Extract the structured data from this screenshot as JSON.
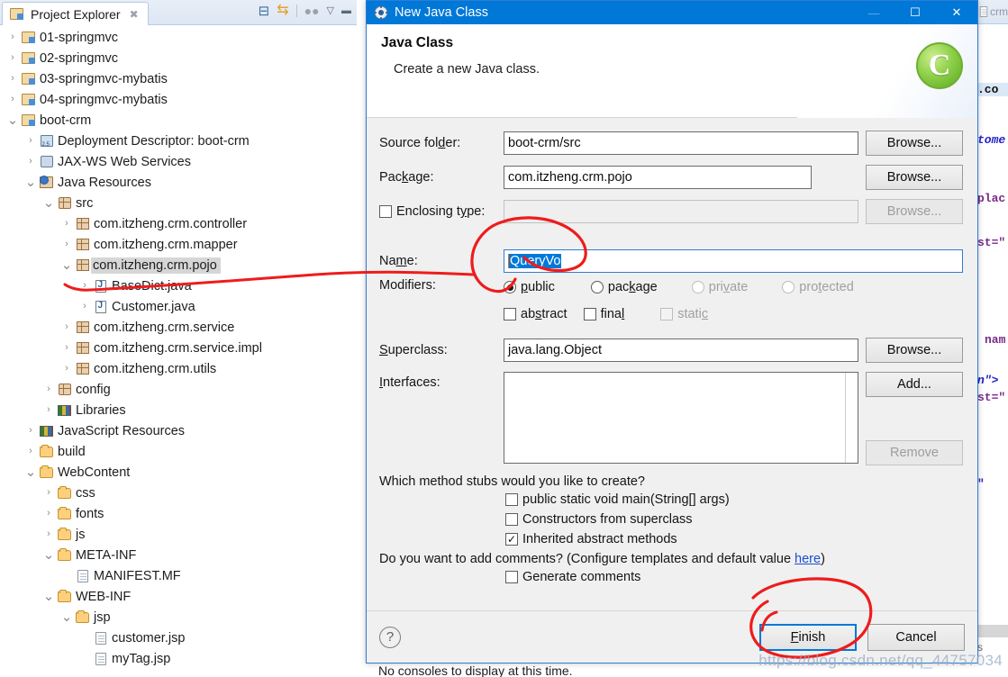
{
  "explorer": {
    "tab_label": "Project Explorer",
    "close_glyph": "✖",
    "toolbar": [
      {
        "name": "collapse-all-icon",
        "glyph": "⊟"
      },
      {
        "name": "link-with-editor-icon",
        "glyph": "⇆"
      },
      {
        "name": "view-menu-icon",
        "glyph": "▽"
      },
      {
        "name": "minimize-view-icon",
        "glyph": "▬"
      }
    ],
    "tree": [
      {
        "label": "01-springmvc",
        "indent": 0,
        "twisty": ">",
        "icon": "project",
        "selected": false
      },
      {
        "label": "02-springmvc",
        "indent": 0,
        "twisty": ">",
        "icon": "project",
        "selected": false
      },
      {
        "label": "03-springmvc-mybatis",
        "indent": 0,
        "twisty": ">",
        "icon": "project",
        "selected": false
      },
      {
        "label": "04-springmvc-mybatis",
        "indent": 0,
        "twisty": ">",
        "icon": "project",
        "selected": false
      },
      {
        "label": "boot-crm",
        "indent": 0,
        "twisty": "v",
        "icon": "project",
        "selected": false
      },
      {
        "label": "Deployment Descriptor: boot-crm",
        "indent": 1,
        "twisty": ">",
        "icon": "deployment",
        "selected": false
      },
      {
        "label": "JAX-WS Web Services",
        "indent": 1,
        "twisty": ">",
        "icon": "webservice",
        "selected": false
      },
      {
        "label": "Java Resources",
        "indent": 1,
        "twisty": "v",
        "icon": "javaresources",
        "selected": false
      },
      {
        "label": "src",
        "indent": 2,
        "twisty": "v",
        "icon": "sourcefolder",
        "selected": false
      },
      {
        "label": "com.itzheng.crm.controller",
        "indent": 3,
        "twisty": ">",
        "icon": "package",
        "selected": false
      },
      {
        "label": "com.itzheng.crm.mapper",
        "indent": 3,
        "twisty": ">",
        "icon": "package",
        "selected": false
      },
      {
        "label": "com.itzheng.crm.pojo",
        "indent": 3,
        "twisty": "v",
        "icon": "package",
        "selected": true
      },
      {
        "label": "BaseDict.java",
        "indent": 4,
        "twisty": ">",
        "icon": "javafile",
        "selected": false
      },
      {
        "label": "Customer.java",
        "indent": 4,
        "twisty": ">",
        "icon": "javafile",
        "selected": false
      },
      {
        "label": "com.itzheng.crm.service",
        "indent": 3,
        "twisty": ">",
        "icon": "package",
        "selected": false
      },
      {
        "label": "com.itzheng.crm.service.impl",
        "indent": 3,
        "twisty": ">",
        "icon": "package",
        "selected": false
      },
      {
        "label": "com.itzheng.crm.utils",
        "indent": 3,
        "twisty": ">",
        "icon": "package",
        "selected": false
      },
      {
        "label": "config",
        "indent": 2,
        "twisty": ">",
        "icon": "sourcefolder",
        "selected": false
      },
      {
        "label": "Libraries",
        "indent": 2,
        "twisty": ">",
        "icon": "library",
        "selected": false
      },
      {
        "label": "JavaScript Resources",
        "indent": 1,
        "twisty": ">",
        "icon": "library",
        "selected": false
      },
      {
        "label": "build",
        "indent": 1,
        "twisty": ">",
        "icon": "folder",
        "selected": false
      },
      {
        "label": "WebContent",
        "indent": 1,
        "twisty": "v",
        "icon": "folder",
        "selected": false
      },
      {
        "label": "css",
        "indent": 2,
        "twisty": ">",
        "icon": "folder",
        "selected": false
      },
      {
        "label": "fonts",
        "indent": 2,
        "twisty": ">",
        "icon": "folder",
        "selected": false
      },
      {
        "label": "js",
        "indent": 2,
        "twisty": ">",
        "icon": "folder",
        "selected": false
      },
      {
        "label": "META-INF",
        "indent": 2,
        "twisty": "v",
        "icon": "folder",
        "selected": false
      },
      {
        "label": "MANIFEST.MF",
        "indent": 3,
        "twisty": "",
        "icon": "file",
        "selected": false
      },
      {
        "label": "WEB-INF",
        "indent": 2,
        "twisty": "v",
        "icon": "folder",
        "selected": false
      },
      {
        "label": "jsp",
        "indent": 3,
        "twisty": "v",
        "icon": "folder",
        "selected": false
      },
      {
        "label": "customer.jsp",
        "indent": 4,
        "twisty": "",
        "icon": "jspfile",
        "selected": false
      },
      {
        "label": "myTag.jsp",
        "indent": 4,
        "twisty": "",
        "icon": "jspfile",
        "selected": false
      }
    ]
  },
  "editor": {
    "tab_label": "crm",
    "lines": [
      ".co",
      "tome",
      "plac",
      "st=\"",
      "nam",
      "n\">",
      "st=\"",
      "\""
    ],
    "status": "s"
  },
  "dialog": {
    "title": "New Java Class",
    "window_controls": {
      "minimize": "—",
      "maximize": "☐",
      "close": "✕"
    },
    "header": {
      "heading": "Java Class",
      "subheading": "Create a new Java class.",
      "wizard_icon_letter": "C"
    },
    "fields": {
      "source_folder_label": "Source folder:",
      "source_folder_value": "boot-crm/src",
      "package_label": "Package:",
      "package_value": "com.itzheng.crm.pojo",
      "enclosing_type_label": "Enclosing type:",
      "enclosing_type_value": "",
      "enclosing_type_checked": false,
      "name_label": "Name:",
      "name_value": "QueryVo",
      "superclass_label": "Superclass:",
      "superclass_value": "java.lang.Object",
      "interfaces_label": "Interfaces:",
      "interfaces_value": ""
    },
    "buttons": {
      "browse": "Browse...",
      "add": "Add...",
      "remove": "Remove"
    },
    "modifiers": {
      "label": "Modifiers:",
      "access": [
        {
          "label": "public",
          "selected": true,
          "disabled": false
        },
        {
          "label": "package",
          "selected": false,
          "disabled": false
        },
        {
          "label": "private",
          "selected": false,
          "disabled": true
        },
        {
          "label": "protected",
          "selected": false,
          "disabled": true
        }
      ],
      "flags": [
        {
          "label": "abstract",
          "checked": false,
          "disabled": false
        },
        {
          "label": "final",
          "checked": false,
          "disabled": false
        },
        {
          "label": "static",
          "checked": false,
          "disabled": true
        }
      ]
    },
    "stubs": {
      "question": "Which method stubs would you like to create?",
      "items": [
        {
          "label": "public static void main(String[] args)",
          "checked": false
        },
        {
          "label": "Constructors from superclass",
          "checked": false
        },
        {
          "label": "Inherited abstract methods",
          "checked": true
        }
      ]
    },
    "comments": {
      "question_prefix": "Do you want to add comments? (Configure templates and default value ",
      "link": "here",
      "question_suffix": ")",
      "checkbox_label": "Generate comments",
      "checked": false
    },
    "footer": {
      "help_glyph": "?",
      "finish_label": "Finish",
      "cancel_label": "Cancel",
      "default_button": "Finish"
    }
  },
  "console": {
    "message": "No consoles to display at this time."
  },
  "annotations": {
    "watermark": "https://blog.csdn.net/qq_44757034",
    "ink_color": "#ee1c1c",
    "marks": [
      {
        "name": "name-field-circle",
        "target": "QueryVo"
      },
      {
        "name": "pojo-package-pointer",
        "target": "com.itzheng.crm.pojo"
      },
      {
        "name": "finish-button-circle",
        "target": "Finish"
      }
    ]
  },
  "colors": {
    "title_bar": "#0078d7",
    "selection": "#0078d7",
    "dialog_bg": "#f0f0f0",
    "tree_selection": "#d6d6d6",
    "ink": "#ee1c1c",
    "link": "#1a4fd0"
  }
}
